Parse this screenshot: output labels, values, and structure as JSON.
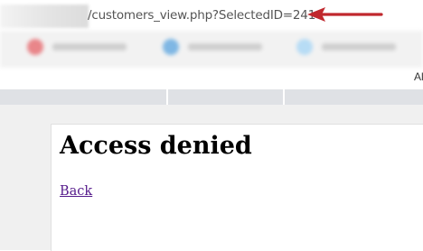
{
  "browser": {
    "url_visible": "/customers_view.php?SelectedID=241",
    "bookmarks_overflow_label": "Al"
  },
  "page": {
    "heading": "Access denied",
    "back_link": "Back"
  },
  "colors": {
    "annotation_arrow": "#c0282d",
    "visited_link": "#551a8b",
    "tab_strip": "#dfe1e5",
    "content_background": "#f0f0f0"
  },
  "icons": {
    "annotation": "arrow-left-icon",
    "bookmark_1": "bookmark-favicon-red",
    "bookmark_2": "bookmark-favicon-blue",
    "bookmark_3": "bookmark-favicon-lightblue"
  }
}
